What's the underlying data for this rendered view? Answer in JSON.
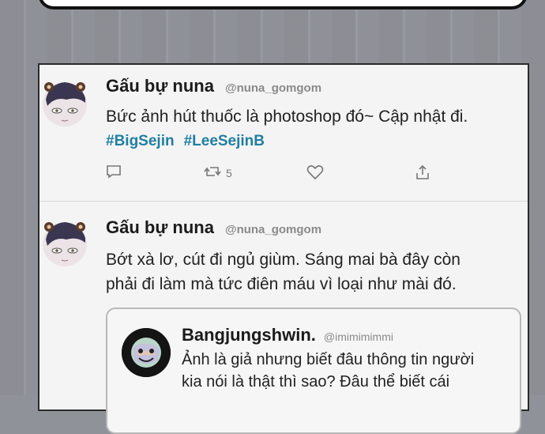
{
  "tweets": [
    {
      "author": "Gấu bự nuna",
      "handle": "@nuna_gomgom",
      "text": "Bức ảnh hút thuốc là photoshop đó~ Cập nhật đi.",
      "hashtags": [
        "#BigSejin",
        "#LeeSejinB"
      ],
      "retweet_count": "5"
    },
    {
      "author": "Gấu bự nuna",
      "handle": "@nuna_gomgom",
      "text_lines": [
        "Bớt xà lơ, cút đi ngủ giùm. Sáng mai bà đây còn",
        "phải đi làm mà tức điên máu vì loại như mài đó."
      ],
      "quoted": {
        "author": "Bangjungshwin.",
        "handle": "@imimimimmi",
        "text_lines": [
          "Ảnh là giả nhưng biết đâu thông tin người",
          "kia nói là thật thì sao? Đâu thể biết cái"
        ]
      }
    }
  ],
  "icons": {
    "reply": "reply-icon",
    "retweet": "retweet-icon",
    "like": "heart-icon",
    "share": "share-icon"
  }
}
